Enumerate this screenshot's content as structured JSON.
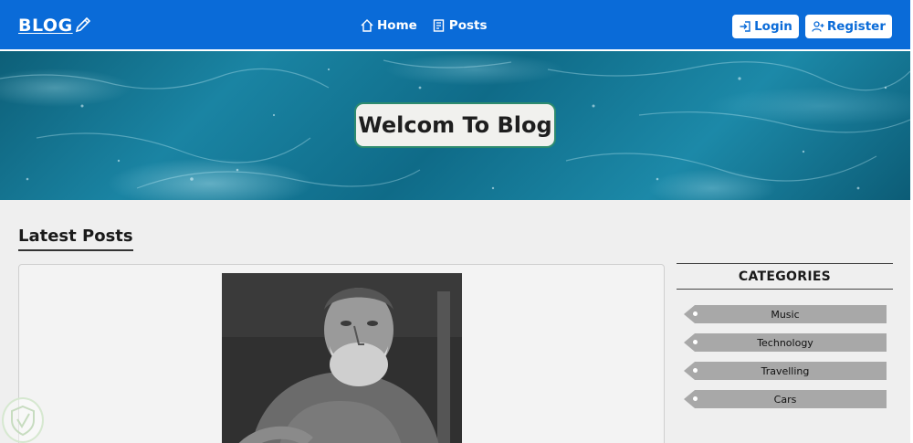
{
  "nav": {
    "brand": "BLOG",
    "links": [
      {
        "label": "Home",
        "icon": "home-icon"
      },
      {
        "label": "Posts",
        "icon": "posts-icon"
      }
    ],
    "login_label": "Login",
    "register_label": "Register"
  },
  "hero": {
    "title": "Welcom To Blog"
  },
  "main": {
    "section_title": "Latest Posts"
  },
  "sidebar": {
    "title": "CATEGORIES",
    "items": [
      "Music",
      "Technology",
      "Travelling",
      "Cars"
    ]
  },
  "colors": {
    "nav_bg": "#0a6bd8",
    "hero_accent": "#1a84a3",
    "category_bg": "#a8a8a8"
  }
}
